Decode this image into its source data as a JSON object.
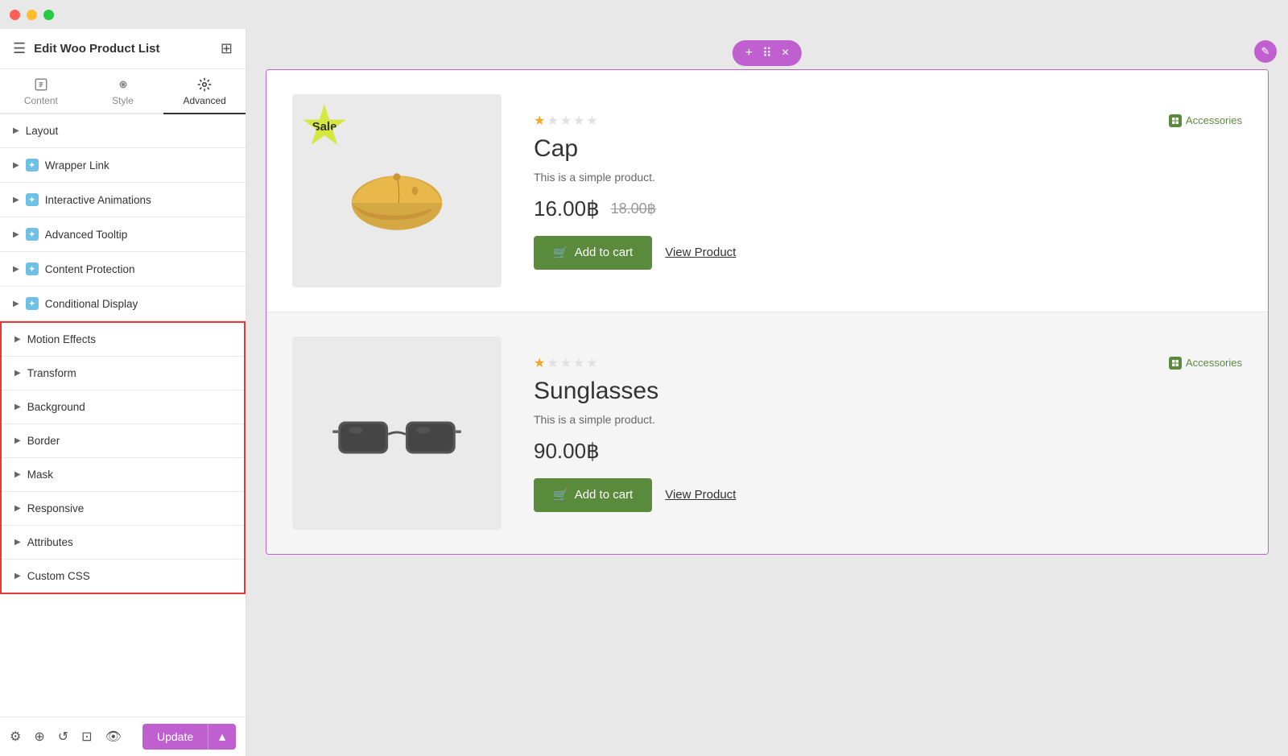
{
  "titlebar": {
    "buttons": [
      "close",
      "minimize",
      "maximize"
    ]
  },
  "sidebar": {
    "title": "Edit Woo Product List",
    "tabs": [
      {
        "id": "content",
        "label": "Content",
        "active": false
      },
      {
        "id": "style",
        "label": "Style",
        "active": false
      },
      {
        "id": "advanced",
        "label": "Advanced",
        "active": true
      }
    ],
    "accordion_items": [
      {
        "id": "layout",
        "label": "Layout",
        "has_icon": false,
        "in_red": false
      },
      {
        "id": "wrapper-link",
        "label": "Wrapper Link",
        "has_icon": true,
        "in_red": false
      },
      {
        "id": "interactive-animations",
        "label": "Interactive Animations",
        "has_icon": true,
        "in_red": false
      },
      {
        "id": "advanced-tooltip",
        "label": "Advanced Tooltip",
        "has_icon": true,
        "in_red": false
      },
      {
        "id": "content-protection",
        "label": "Content Protection",
        "has_icon": true,
        "in_red": false
      },
      {
        "id": "conditional-display",
        "label": "Conditional Display",
        "has_icon": true,
        "in_red": false
      },
      {
        "id": "motion-effects",
        "label": "Motion Effects",
        "has_icon": false,
        "in_red": true
      },
      {
        "id": "transform",
        "label": "Transform",
        "has_icon": false,
        "in_red": true
      },
      {
        "id": "background",
        "label": "Background",
        "has_icon": false,
        "in_red": true
      },
      {
        "id": "border",
        "label": "Border",
        "has_icon": false,
        "in_red": true
      },
      {
        "id": "mask",
        "label": "Mask",
        "has_icon": false,
        "in_red": true
      },
      {
        "id": "responsive",
        "label": "Responsive",
        "has_icon": false,
        "in_red": true
      },
      {
        "id": "attributes",
        "label": "Attributes",
        "has_icon": false,
        "in_red": true
      },
      {
        "id": "custom-css",
        "label": "Custom CSS",
        "has_icon": false,
        "in_red": true
      }
    ],
    "bottom": {
      "update_label": "Update"
    }
  },
  "toolbar": {
    "plus": "+",
    "move": "⠿",
    "close": "×"
  },
  "products": [
    {
      "id": "cap",
      "name": "Cap",
      "description": "This is a simple product.",
      "price_current": "16.00฿",
      "price_old": "18.00฿",
      "has_sale": true,
      "sale_label": "Sale",
      "category": "Accessories",
      "add_to_cart": "Add to cart",
      "view_product": "View Product",
      "stars": [
        true,
        false,
        false,
        false,
        false
      ]
    },
    {
      "id": "sunglasses",
      "name": "Sunglasses",
      "description": "This is a simple product.",
      "price_current": "90.00฿",
      "price_old": "",
      "has_sale": false,
      "sale_label": "",
      "category": "Accessories",
      "add_to_cart": "Add to cart",
      "view_product": "View Product",
      "stars": [
        true,
        false,
        false,
        false,
        false
      ]
    }
  ]
}
